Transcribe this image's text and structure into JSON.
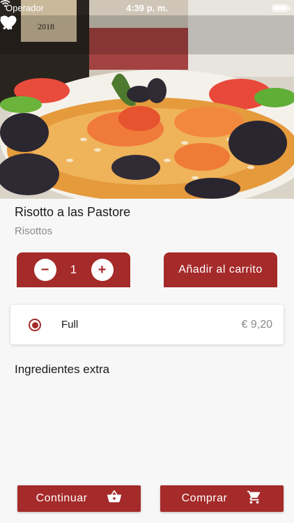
{
  "status_bar": {
    "carrier": "Operador",
    "time": "4:39 p. m."
  },
  "hero": {
    "bottle_label_text": "2018"
  },
  "topbar": {
    "back_icon": "arrow-back-icon",
    "favorite_icon": "heart-icon",
    "cart_icon": "cart-icon"
  },
  "product": {
    "name": "Risotto a las Pastore",
    "category": "Risottos"
  },
  "quantity": {
    "value": "1",
    "minus": "−",
    "plus": "+"
  },
  "add_to_cart_label": "Añadir al carrito",
  "option": {
    "name": "Full",
    "price": "€ 9,20",
    "selected": true
  },
  "extras_title": "Ingredientes extra",
  "actions": {
    "continue_label": "Continuar",
    "buy_label": "Comprar"
  },
  "colors": {
    "accent": "#a52a2a",
    "background": "#f7f7f7"
  }
}
